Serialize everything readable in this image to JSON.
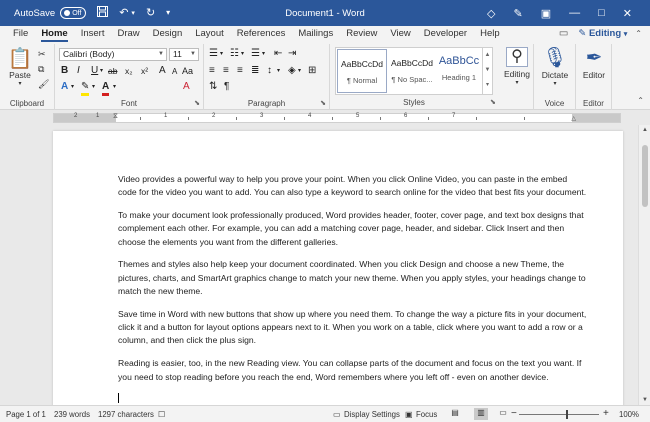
{
  "titlebar": {
    "autosave_label": "AutoSave",
    "autosave_state": "Off",
    "document_title": "Document1 - Word",
    "icons": [
      "save-icon",
      "undo-icon",
      "redo-icon",
      "customize-icon",
      "diamond-icon",
      "pen-icon",
      "ribbon-display-icon",
      "minimize-icon",
      "restore-icon",
      "close-icon"
    ]
  },
  "tabs": [
    "File",
    "Home",
    "Insert",
    "Draw",
    "Design",
    "Layout",
    "References",
    "Mailings",
    "Review",
    "View",
    "Developer",
    "Help"
  ],
  "active_tab": "Home",
  "editing_mode": "Editing",
  "ribbon": {
    "clipboard": {
      "paste_label": "Paste",
      "group_label": "Clipboard"
    },
    "font": {
      "font_name": "Calibri (Body)",
      "font_size": "11",
      "group_label": "Font",
      "grow": "A",
      "shrink": "A",
      "case": "Aa",
      "bold": "B",
      "italic": "I",
      "underline": "U",
      "strike": "ab",
      "subscript": "x₂",
      "superscript": "x²",
      "clear": "A"
    },
    "paragraph": {
      "group_label": "Paragraph"
    },
    "styles": {
      "group_label": "Styles",
      "items": [
        {
          "sample": "AaBbCcDd",
          "name": "¶ Normal"
        },
        {
          "sample": "AaBbCcDd",
          "name": "¶ No Spac..."
        },
        {
          "sample": "AaBbCc",
          "name": "Heading 1"
        }
      ]
    },
    "editing": {
      "label": "Editing"
    },
    "voice": {
      "dictate_label": "Dictate",
      "group_label": "Voice"
    },
    "editor": {
      "label": "Editor",
      "group_label": "Editor"
    }
  },
  "ruler": {
    "labels": [
      "2",
      "1",
      "1",
      "2",
      "3",
      "4",
      "5",
      "6",
      "7"
    ]
  },
  "document": {
    "paragraphs": [
      "Video provides a powerful way to help you prove your point. When you click Online Video, you can paste in the embed code for the video you want to add. You can also type a keyword to search online for the video that best fits your document.",
      "To make your document look professionally produced, Word provides header, footer, cover page, and text box designs that complement each other. For example, you can add a matching cover page, header, and sidebar. Click Insert and then choose the elements you want from the different galleries.",
      "Themes and styles also help keep your document coordinated. When you click Design and choose a new Theme, the pictures, charts, and SmartArt graphics change to match your new theme. When you apply styles, your headings change to match the new theme.",
      "Save time in Word with new buttons that show up where you need them. To change the way a picture fits in your document, click it and a button for layout options appears next to it. When you work on a table, click where you want to add a row or a column, and then click the plus sign.",
      "Reading is easier, too, in the new Reading view. You can collapse parts of the document and focus on the text you want. If you need to stop reading before you reach the end, Word remembers where you left off - even on another device."
    ]
  },
  "statusbar": {
    "page": "Page 1 of 1",
    "words": "239 words",
    "characters": "1297 characters",
    "display_settings": "Display Settings",
    "focus": "Focus",
    "zoom_out": "−",
    "zoom_in": "+",
    "zoom": "100%"
  }
}
